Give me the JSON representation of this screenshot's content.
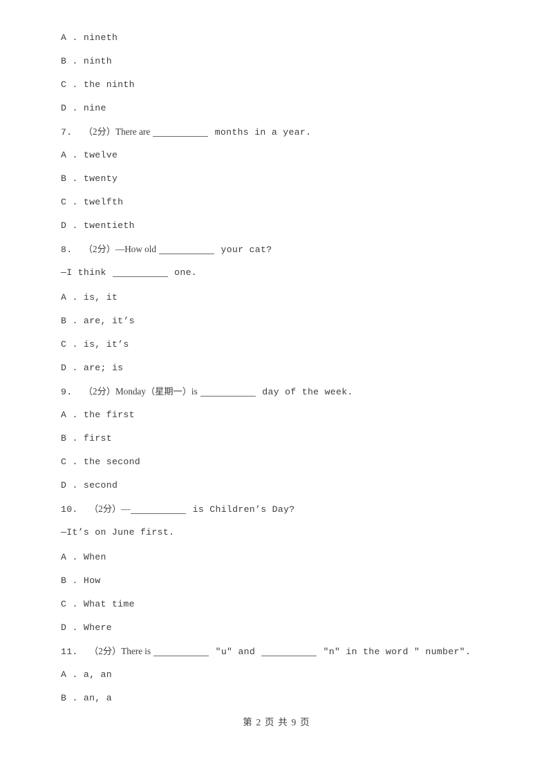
{
  "page": {
    "footer": "第 2 页 共 9 页",
    "page_number": "2",
    "total_pages": "9"
  },
  "blocks": [
    {
      "type": "option",
      "letter": "A",
      "sep": ".",
      "text": "nineth"
    },
    {
      "type": "option",
      "letter": "B",
      "sep": ".",
      "text": "ninth"
    },
    {
      "type": "option",
      "letter": "C",
      "sep": ".",
      "text": "the ninth"
    },
    {
      "type": "option",
      "letter": "D",
      "sep": ".",
      "text": "nine"
    },
    {
      "type": "question",
      "number": "7.",
      "marks": "（2分）",
      "pre": "There are ",
      "blank": true,
      "post": " months in a year."
    },
    {
      "type": "option",
      "letter": "A",
      "sep": ".",
      "text": "twelve"
    },
    {
      "type": "option",
      "letter": "B",
      "sep": ".",
      "text": "twenty"
    },
    {
      "type": "option",
      "letter": "C",
      "sep": ".",
      "text": "twelfth"
    },
    {
      "type": "option",
      "letter": "D",
      "sep": ".",
      "text": "twentieth"
    },
    {
      "type": "question",
      "number": "8.",
      "marks": "（2分）",
      "pre": "—How old ",
      "blank": true,
      "post": " your cat?"
    },
    {
      "type": "continuation",
      "pre": "—I think ",
      "blank": true,
      "post": " one."
    },
    {
      "type": "option",
      "letter": "A",
      "sep": ".",
      "text": "is, it"
    },
    {
      "type": "option",
      "letter": "B",
      "sep": ".",
      "text": "are, it’s"
    },
    {
      "type": "option",
      "letter": "C",
      "sep": ".",
      "text": "is, it’s"
    },
    {
      "type": "option",
      "letter": "D",
      "sep": ".",
      "text": "are; is"
    },
    {
      "type": "question",
      "number": "9.",
      "marks": "（2分）",
      "pre": "Monday（星期一）is ",
      "blank": true,
      "post": " day of the week."
    },
    {
      "type": "option",
      "letter": "A",
      "sep": ".",
      "text": "the first"
    },
    {
      "type": "option",
      "letter": "B",
      "sep": ".",
      "text": "first"
    },
    {
      "type": "option",
      "letter": "C",
      "sep": ".",
      "text": "the second"
    },
    {
      "type": "option",
      "letter": "D",
      "sep": ".",
      "text": "second"
    },
    {
      "type": "question",
      "number": "10.",
      "marks": "（2分）",
      "pre": "—",
      "blank": true,
      "post": " is Children’s Day?"
    },
    {
      "type": "continuation",
      "pre": "—It’s on June first.",
      "blank": false,
      "post": ""
    },
    {
      "type": "option",
      "letter": "A",
      "sep": ".",
      "text": "When"
    },
    {
      "type": "option",
      "letter": "B",
      "sep": ".",
      "text": "How"
    },
    {
      "type": "option",
      "letter": "C",
      "sep": ".",
      "text": "What time"
    },
    {
      "type": "option",
      "letter": "D",
      "sep": ".",
      "text": "Where"
    },
    {
      "type": "question",
      "number": "11.",
      "marks": "（2分）",
      "pre": "There is ",
      "blank": true,
      "mid": " ″u″ and ",
      "blank2": true,
      "post": " ″n″ in the word ″ number″."
    },
    {
      "type": "option",
      "letter": "A",
      "sep": ".",
      "text": "a, an"
    },
    {
      "type": "option",
      "letter": "B",
      "sep": ".",
      "text": "an, a"
    }
  ]
}
